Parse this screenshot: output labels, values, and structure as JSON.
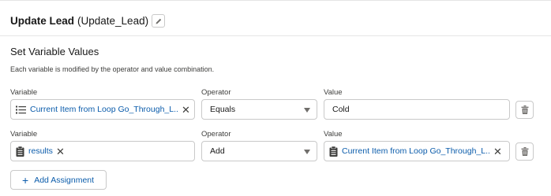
{
  "header": {
    "title": "Update Lead",
    "api_name": "(Update_Lead)",
    "edit_icon": "pencil-icon"
  },
  "section": {
    "title": "Set Variable Values",
    "help_text": "Each variable is modified by the operator and value combination."
  },
  "assignments": [
    {
      "variable_label": "Variable",
      "variable_value": "Current Item from Loop Go_Through_L...",
      "variable_icon": "list-icon",
      "operator_label": "Operator",
      "operator_value": "Equals",
      "value_label": "Value",
      "value_value": "Cold"
    },
    {
      "variable_label": "Variable",
      "variable_value": "results",
      "variable_icon": "clipboard-icon",
      "operator_label": "Operator",
      "operator_value": "Add",
      "value_label": "Value",
      "value_value": "Current Item from Loop Go_Through_L...",
      "value_icon": "clipboard-icon"
    }
  ],
  "add_button": {
    "label": "Add Assignment"
  }
}
